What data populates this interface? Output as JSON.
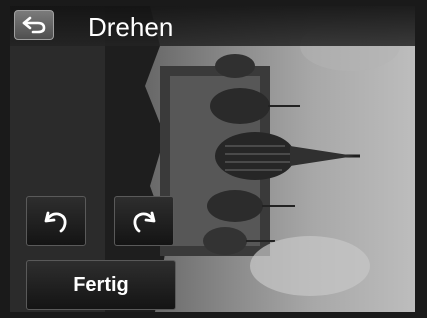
{
  "header": {
    "title": "Drehen",
    "back_icon": "back-arrow-icon"
  },
  "controls": {
    "rotate_left_icon": "rotate-left-icon",
    "rotate_right_icon": "rotate-right-icon",
    "done_label": "Fertig"
  },
  "colors": {
    "title_bar": "#1a1a1a",
    "button_face": "#1e1e1e",
    "back_button": "#6a6a6a",
    "text": "#ffffff"
  }
}
